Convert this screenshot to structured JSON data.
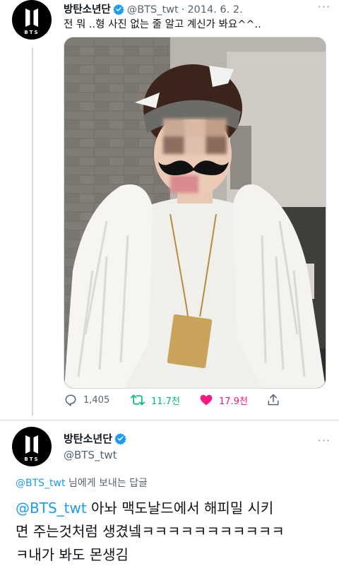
{
  "tweet1": {
    "avatar_label": "BTS logo avatar",
    "name": "방탄소년단",
    "handle": "@BTS_twt",
    "separator": "·",
    "date": "2014. 6. 2.",
    "more": "···",
    "text": "전 뭐 ..형 사진 없는 줄 알고 계신가 봐요^^..",
    "image_alt": "Photo of a person wearing a bandana headband, white fur vest and a drawn-on mustache",
    "actions": {
      "replies": "1,405",
      "retweets": "11.7천",
      "likes": "17.9천"
    }
  },
  "tweet2": {
    "name": "방탄소년단",
    "handle": "@BTS_twt",
    "more": "···",
    "reply_to_mention": "@BTS_twt",
    "reply_to_suffix": " 님에게 보내는 답글",
    "body_mention": "@BTS_twt",
    "body_line1": " 아놔 맥도날드에서 해피밀 시키",
    "body_line2": "면 주는것처럼 생겼넼ㅋㅋㅋㅋㅋㅋㅋㅋㅋㅋㅋ",
    "body_line3": "ㅋ내가 봐도 몬생김"
  },
  "colors": {
    "text": "#0f1419",
    "secondary": "#536471",
    "accent": "#1d9bf0",
    "retweet": "#00ba7c",
    "like": "#f91880",
    "border": "#cfd9de"
  },
  "icons": [
    "bts-logo-icon",
    "verified-badge-icon",
    "reply-icon",
    "retweet-icon",
    "heart-icon",
    "share-icon",
    "more-icon"
  ]
}
